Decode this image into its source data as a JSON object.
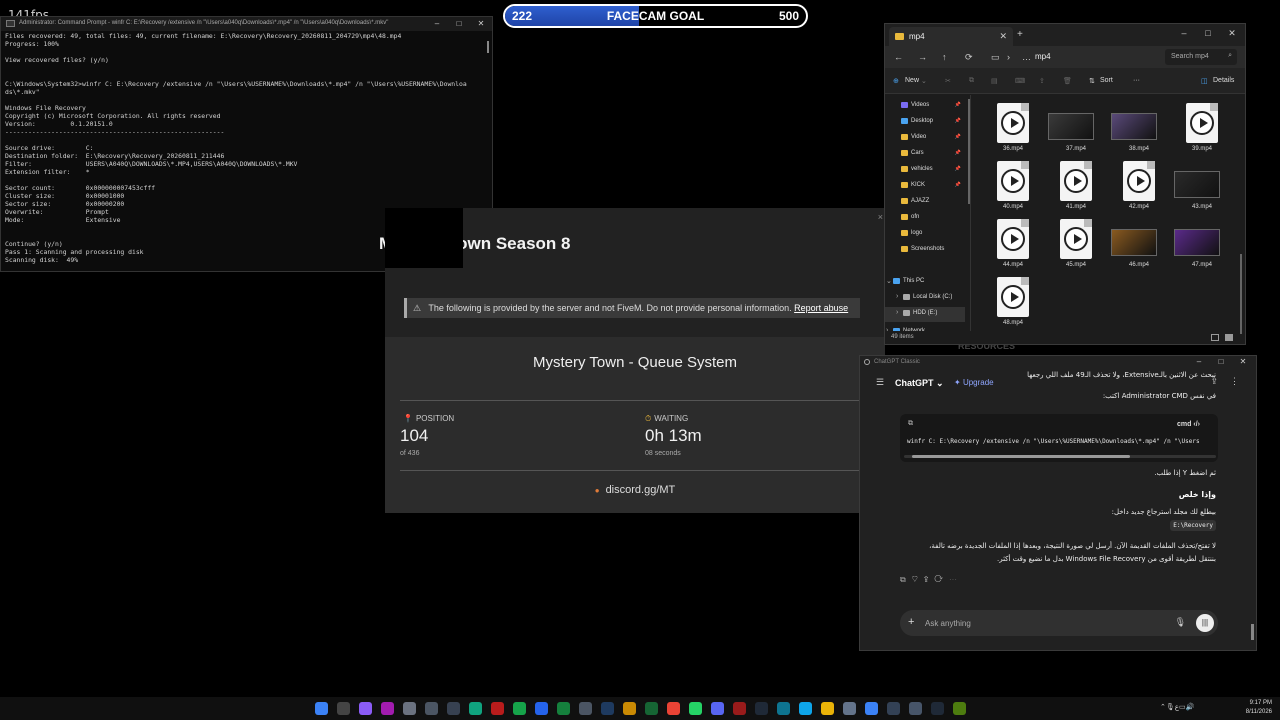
{
  "overlay": {
    "fps": "141fps",
    "goal": {
      "current": "222",
      "label": "FACECAM GOAL",
      "target": "500",
      "progress": 0.444
    }
  },
  "cmd": {
    "title": "Administrator: Command Prompt - winfr  C: E:\\Recovery /extensive /n \"\\Users\\a040q\\Downloads\\*.mp4\" /n \"\\Users\\a040q\\Downloads\\*.mkv\"",
    "output": "Files recovered: 49, total files: 49, current filename: E:\\Recovery\\Recovery_20260811_204729\\mp4\\48.mp4\nProgress: 100%\n\nView recovered files? (y/n)\n\n\nC:\\Windows\\System32>winfr C: E:\\Recovery /extensive /n \"\\Users\\%USERNAME%\\Downloads\\*.mp4\" /n \"\\Users\\%USERNAME%\\Downloa\nds\\*.mkv\"\n\nWindows File Recovery\nCopyright (c) Microsoft Corporation. All rights reserved\nVersion:         0.1.20151.0\n---------------------------------------------------------\n\nSource drive:        C:\nDestination folder:  E:\\Recovery\\Recovery_20260811_211446\nFilter:              USERS\\A040Q\\DOWNLOADS\\*.MP4,USERS\\A040Q\\DOWNLOADS\\*.MKV\nExtension filter:    *\n\nSector count:        0x000000007453cfff\nCluster size:        0x00001000\nSector size:         0x00000200\nOverwrite:           Prompt\nMode:                Extensive\n\n\nContinue? (y/n)\nPass 1: Scanning and processing disk\nScanning disk:  49%"
  },
  "fivem": {
    "server_title": "Mystery Town Season 8",
    "notice": "The following is provided by the server and not FiveM. Do not provide personal information.",
    "report_link": "Report abuse",
    "queue_title": "Mystery Town - Queue System",
    "position_label": "POSITION",
    "position_value": "104",
    "position_sub": "of 436",
    "waiting_label": "WAITING",
    "waiting_value": "0h 13m",
    "waiting_sub": "08 seconds",
    "discord": "discord.gg/MT",
    "close": "×",
    "bg_resources": "RESOURCES"
  },
  "explorer": {
    "tab": "mp4",
    "path": "mp4",
    "search_placeholder": "Search mp4",
    "toolbar": {
      "new": "New",
      "sort": "Sort",
      "details": "Details"
    },
    "sidebar": [
      {
        "label": "Videos",
        "color": "#7a6cf2",
        "pinned": true
      },
      {
        "label": "Desktop",
        "color": "#4aa3f0",
        "pinned": true
      },
      {
        "label": "Video",
        "color": "#e9b93c",
        "pinned": true
      },
      {
        "label": "Cars",
        "color": "#e9b93c",
        "pinned": true
      },
      {
        "label": "vehicles",
        "color": "#e9b93c",
        "pinned": true
      },
      {
        "label": "KICK",
        "color": "#e9b93c",
        "pinned": true
      },
      {
        "label": "AJAZZ",
        "color": "#e9b93c",
        "pinned": false
      },
      {
        "label": "ofn",
        "color": "#e9b93c",
        "pinned": false
      },
      {
        "label": "logo",
        "color": "#e9b93c",
        "pinned": false
      },
      {
        "label": "Screenshots",
        "color": "#e9b93c",
        "pinned": false
      },
      {
        "label": "This PC",
        "color": "#4aa3f0",
        "pinned": false
      },
      {
        "label": "Local Disk (C:)",
        "color": "#aaaaaa",
        "pinned": false
      },
      {
        "label": "HDD (E:)",
        "color": "#aaaaaa",
        "pinned": false
      },
      {
        "label": "Network",
        "color": "#4aa3f0",
        "pinned": false
      }
    ],
    "files": [
      {
        "name": "36.mp4",
        "kind": "doc"
      },
      {
        "name": "37.mp4",
        "kind": "thumb",
        "color": "#3a3a3a"
      },
      {
        "name": "38.mp4",
        "kind": "thumb",
        "color": "#5a4a7a"
      },
      {
        "name": "39.mp4",
        "kind": "doc"
      },
      {
        "name": "40.mp4",
        "kind": "doc"
      },
      {
        "name": "41.mp4",
        "kind": "doc"
      },
      {
        "name": "42.mp4",
        "kind": "doc"
      },
      {
        "name": "43.mp4",
        "kind": "thumb",
        "color": "#2a2a2a"
      },
      {
        "name": "44.mp4",
        "kind": "doc"
      },
      {
        "name": "45.mp4",
        "kind": "doc"
      },
      {
        "name": "46.mp4",
        "kind": "thumb",
        "color": "#8a5a20"
      },
      {
        "name": "47.mp4",
        "kind": "thumb",
        "color": "#5a2a8a"
      },
      {
        "name": "48.mp4",
        "kind": "doc"
      }
    ],
    "status": "49 items"
  },
  "chat": {
    "window_title": "ChatGPT Classic",
    "model": "ChatGPT",
    "upgrade": "Upgrade",
    "line1": "نبحث عن الاثنين بالـExtensive، ولا تحذف الـ49 ملف اللي رجعها",
    "line2": "في نفس Administrator CMD اكتب:",
    "code_lang": "cmd",
    "code": "winfr C: E:\\Recovery /extensive /n \"\\Users\\%USERNAME%\\Downloads\\*.mp4\" /n \"\\Users",
    "line3": "ثم اضغط Y إذا طلب.",
    "heading": "وإذا خلص",
    "line4": "بيطلع لك مجلد استرجاع جديد داخل:",
    "path": "E:\\Recovery",
    "line5": "لا تفتح/تحذف الملفات القديمة الآن. أرسل لي صورة النتيجة، وبعدها إذا الملفات الجديدة برضه تالفة،",
    "line6": "بننتقل لطريقة أقوى من Windows File Recovery بدل ما نضيع وقت أكثر.",
    "input_placeholder": "Ask anything"
  },
  "taskbar": {
    "icons": [
      {
        "name": "start",
        "color": "#3b82f6"
      },
      {
        "name": "search",
        "color": "#444444"
      },
      {
        "name": "music",
        "color": "#8b5cf6"
      },
      {
        "name": "nexus",
        "color": "#a21caf"
      },
      {
        "name": "app-a",
        "color": "#6b7280"
      },
      {
        "name": "app-b",
        "color": "#4b5563"
      },
      {
        "name": "app-c",
        "color": "#374151"
      },
      {
        "name": "chatgpt",
        "color": "#10a37f"
      },
      {
        "name": "app-d",
        "color": "#b91c1c"
      },
      {
        "name": "nvidia",
        "color": "#16a34a"
      },
      {
        "name": "app-e",
        "color": "#2563eb"
      },
      {
        "name": "xbox",
        "color": "#15803d"
      },
      {
        "name": "app-f",
        "color": "#4b5563"
      },
      {
        "name": "steam",
        "color": "#1e3a5f"
      },
      {
        "name": "app-g",
        "color": "#ca8a04"
      },
      {
        "name": "app-h",
        "color": "#166534"
      },
      {
        "name": "chrome",
        "color": "#ea4335"
      },
      {
        "name": "whatsapp",
        "color": "#25d366"
      },
      {
        "name": "discord",
        "color": "#5865f2"
      },
      {
        "name": "app-i",
        "color": "#991b1b"
      },
      {
        "name": "app-j",
        "color": "#1f2937"
      },
      {
        "name": "app-k",
        "color": "#0e7490"
      },
      {
        "name": "edge",
        "color": "#0ea5e9"
      },
      {
        "name": "explorer",
        "color": "#eab308"
      },
      {
        "name": "app-l",
        "color": "#64748b"
      },
      {
        "name": "app-m",
        "color": "#3b82f6"
      },
      {
        "name": "app-n",
        "color": "#334155"
      },
      {
        "name": "settings",
        "color": "#475569"
      },
      {
        "name": "terminal",
        "color": "#1f2937"
      },
      {
        "name": "app-o",
        "color": "#4d7c0f"
      }
    ],
    "time": "9:17 PM",
    "date": "8/11/2026"
  }
}
